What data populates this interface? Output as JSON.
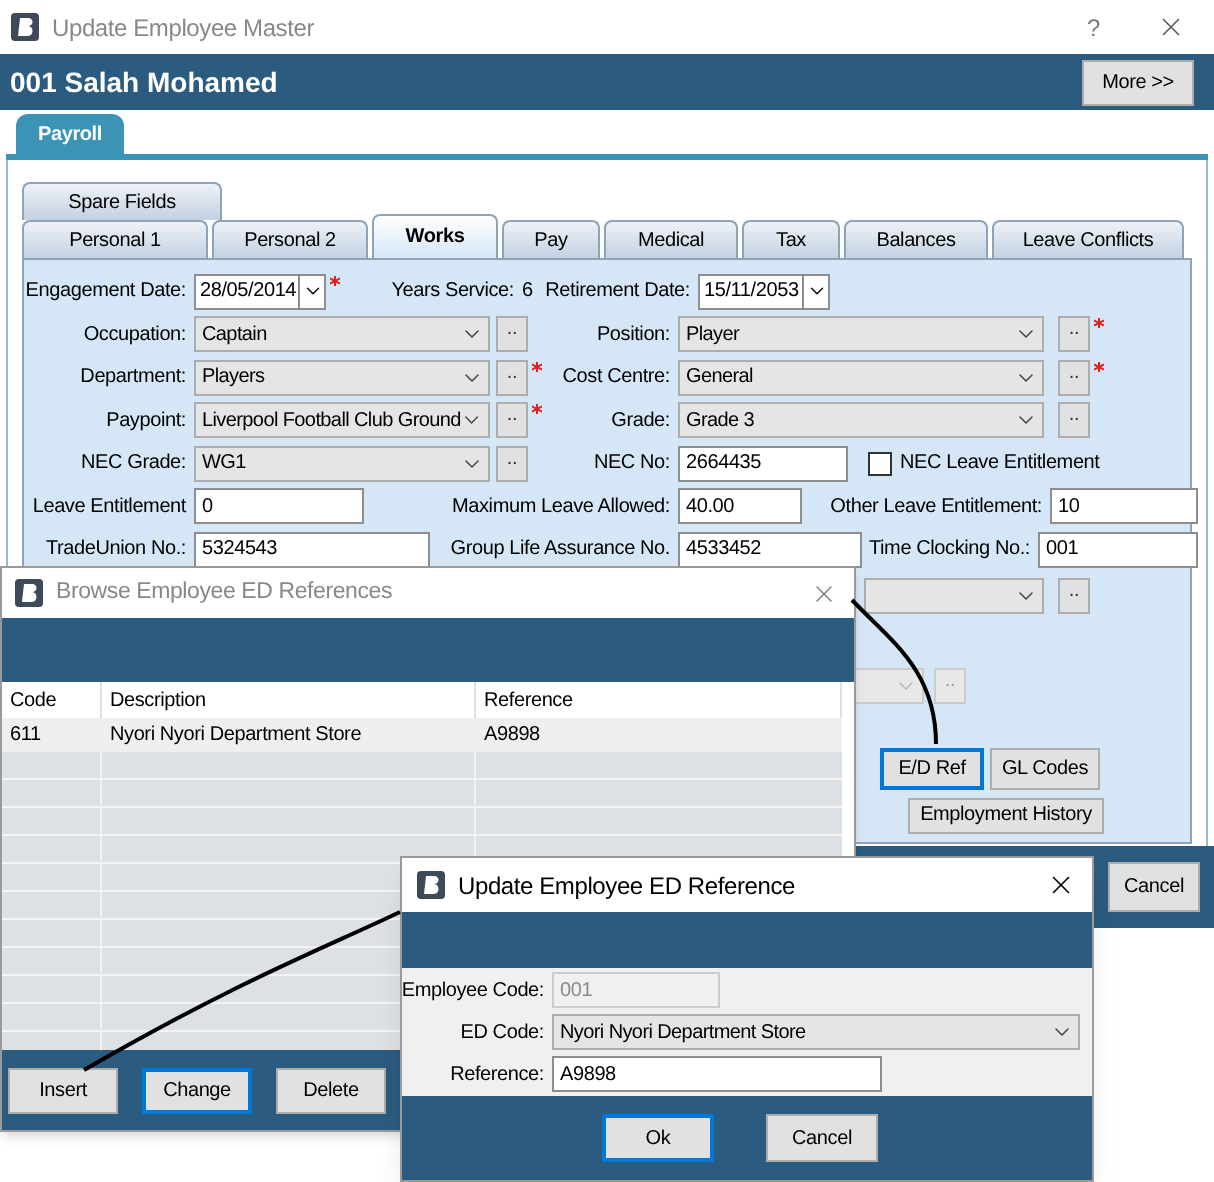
{
  "main_window": {
    "title": "Update Employee Master",
    "help": "?",
    "header": {
      "employee": "001 Salah Mohamed",
      "more_button": "More >>"
    },
    "module_tabs": [
      {
        "label": "Payroll",
        "selected": true
      }
    ],
    "tab_rows": [
      [
        {
          "label": "Spare Fields",
          "selected": false
        }
      ],
      [
        {
          "label": "Personal 1",
          "selected": false
        },
        {
          "label": "Personal 2",
          "selected": false
        },
        {
          "label": "Works",
          "selected": true
        },
        {
          "label": "Pay",
          "selected": false
        },
        {
          "label": "Medical",
          "selected": false
        },
        {
          "label": "Tax",
          "selected": false
        },
        {
          "label": "Balances",
          "selected": false
        },
        {
          "label": "Leave Conflicts",
          "selected": false
        }
      ]
    ],
    "engagement_date": {
      "label": "Engagement Date:",
      "value": "28/05/2014",
      "required": true
    },
    "years_service": {
      "label": "Years Service:",
      "value": "6"
    },
    "retirement_date": {
      "label": "Retirement Date:",
      "value": "15/11/2053"
    },
    "lookup_rows": [
      {
        "left": {
          "label": "Occupation:",
          "value": "Captain",
          "button": "..",
          "required": false
        },
        "right": {
          "label": "Position:",
          "value": "Player",
          "button": "..",
          "required": true
        }
      },
      {
        "left": {
          "label": "Department:",
          "value": "Players",
          "button": "..",
          "required": true
        },
        "right": {
          "label": "Cost Centre:",
          "value": "General",
          "button": "..",
          "required": true
        }
      },
      {
        "left": {
          "label": "Paypoint:",
          "value": "Liverpool Football Club Ground",
          "button": "..",
          "required": true
        },
        "right": {
          "label": "Grade:",
          "value": "Grade 3",
          "button": "..",
          "required": false
        }
      }
    ],
    "nec_grade": {
      "label": "NEC Grade:",
      "value": "WG1",
      "button": "..",
      "required": false
    },
    "nec_no": {
      "label": "NEC No:",
      "value": "2664435"
    },
    "nec_leave_entitlement": {
      "label": "NEC Leave Entitlement",
      "checked": false
    },
    "text_rows": [
      [
        {
          "label": "Leave Entitlement",
          "value": "0"
        },
        {
          "label": "Maximum Leave Allowed:",
          "value": "40.00"
        },
        {
          "label": "Other Leave Entitlement:",
          "value": "10"
        }
      ],
      [
        {
          "label": "TradeUnion No.:",
          "value": "5324543"
        },
        {
          "label": "Group Life Assurance No.",
          "value": "4533452"
        },
        {
          "label": "Time Clocking No.:",
          "value": "001"
        }
      ]
    ],
    "partial_lookups": [
      {
        "button": "..",
        "disabled": false
      },
      {
        "button": "..",
        "disabled": true
      }
    ],
    "action_buttons": [
      {
        "label": "E/D Ref",
        "focused": true
      },
      {
        "label": "GL Codes",
        "focused": false
      }
    ],
    "employment_history_button": "Employment History",
    "cancel_button": "Cancel"
  },
  "browse_window": {
    "title": "Browse Employee ED References",
    "columns": [
      "Code",
      "Description",
      "Reference"
    ],
    "rows": [
      [
        "611",
        "Nyori Nyori Department Store",
        "A9898"
      ]
    ],
    "buttons": [
      {
        "label": "Insert",
        "focused": false
      },
      {
        "label": "Change",
        "focused": true
      },
      {
        "label": "Delete",
        "focused": false
      }
    ]
  },
  "update_dialog": {
    "title": "Update Employee ED Reference",
    "employee_code": {
      "label": "Employee Code:",
      "value": "001",
      "disabled": true
    },
    "ed_code": {
      "label": "ED Code:",
      "value": "Nyori Nyori Department Store"
    },
    "reference": {
      "label": "Reference:",
      "value": "A9898"
    },
    "buttons": [
      {
        "label": "Ok",
        "focused": true
      },
      {
        "label": "Cancel",
        "focused": false
      }
    ]
  }
}
